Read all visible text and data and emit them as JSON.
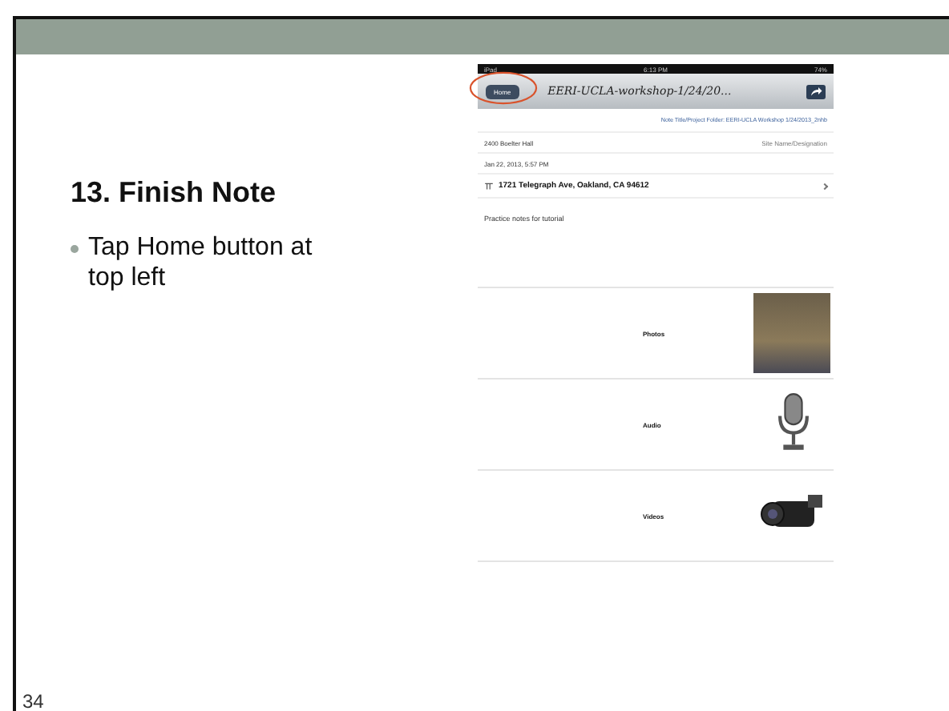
{
  "slide": {
    "title": "13. Finish Note",
    "bullets": [
      "Tap Home button at top left"
    ],
    "page_number": "34"
  },
  "ipad": {
    "status_bar": {
      "carrier": "iPad",
      "time": "6:13 PM",
      "battery": "74%"
    },
    "nav": {
      "back_button": "Home",
      "title": "EERI-UCLA-workshop-1/24/20..."
    },
    "subtitle": "Note Title/Project Folder: EERI-UCLA Workshop 1/24/2013_2nhb",
    "rows": [
      {
        "kind": "text",
        "text": "2400 Boelter Hall",
        "detail": "Site Name/Designation"
      },
      {
        "kind": "text",
        "text": "Jan 22, 2013, 5:57 PM"
      },
      {
        "kind": "address",
        "text": "1721 Telegraph Ave, Oakland, CA 94612"
      },
      {
        "kind": "note",
        "text": "Practice notes for tutorial"
      }
    ],
    "media": [
      {
        "kind": "photo",
        "label": "Photos"
      },
      {
        "kind": "audio",
        "label": "Audio"
      },
      {
        "kind": "video",
        "label": "Videos"
      }
    ]
  }
}
